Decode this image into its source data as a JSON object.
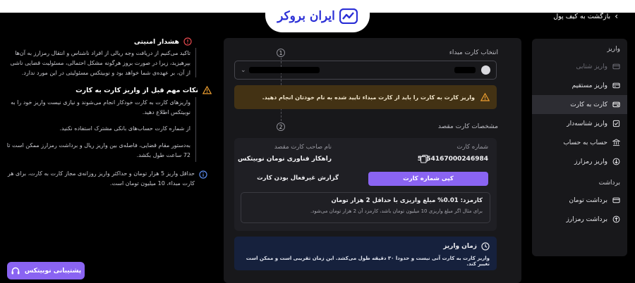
{
  "header": {
    "brand": "ایران بروکر",
    "back_label": "بازگشت به کیف پول"
  },
  "sidebar": {
    "section_deposit": "واریز",
    "deposit_items": [
      {
        "label": "واریز شتابی",
        "icon": "shetab-icon",
        "state": "disabled"
      },
      {
        "label": "واریز مستقیم",
        "icon": "bank-card-icon",
        "state": "normal"
      },
      {
        "label": "کارت به کارت",
        "icon": "card-transfer-icon",
        "state": "active"
      },
      {
        "label": "واریز شناسه‌دار",
        "icon": "id-deposit-icon",
        "state": "normal"
      },
      {
        "label": "حساب به حساب",
        "icon": "bank-building-icon",
        "state": "normal"
      },
      {
        "label": "واریز رمزارز",
        "icon": "crypto-deposit-icon",
        "state": "normal"
      }
    ],
    "section_withdraw": "برداشت",
    "withdraw_items": [
      {
        "label": "برداشت تومان",
        "icon": "toman-withdraw-icon"
      },
      {
        "label": "برداشت رمزارز",
        "icon": "crypto-withdraw-icon"
      }
    ]
  },
  "main": {
    "step1": {
      "number": "1",
      "label": "انتخاب کارت مبداء"
    },
    "step2": {
      "number": "2",
      "label": "مشخصات کارت مقصد"
    },
    "origin_warning": "واریز کارت به کارت را باید از کارت مبداء تایید شده به نام خودتان انجام دهید.",
    "destination": {
      "card_number_header": "شماره کارت",
      "owner_header": "نام صاحب کارت مقصد",
      "card_number": "5054167000246984",
      "owner_name": "راهکار فناوری نومان نوبیتکس",
      "copy_button": "کپی شماره کارت",
      "report_link": "گزارش غیرفعال بودن کارت"
    },
    "fee": {
      "title": "کارمزد: 0.01% مبلغ واریزی با حداقل 2 هزار تومان",
      "example": "برای مثال اگر مبلغ واریزی 10 میلیون تومان باشد، کارمزد آن 2 هزار تومان می‌شود."
    },
    "deposit_time": {
      "title": "زمان واریز",
      "text": "واریز کارت به کارت آنی نیست و حدودا ۳۰ دقیقه طول می‌کشد. این زمان تقریبی است و ممکن است تغییر کند."
    }
  },
  "notices": {
    "security_title": "هشدار امنیتی",
    "security_text": "تاکید می‌کنیم از دریافت وجه ریالی از افراد ناشناس و انتقال رمزارز به آن‌ها بپرهیزید، زیرا در صورت بروز هرگونه مشکل احتمالی، مسئولیت قضایی ناشی از آن، بر عهده‌ی شما خواهد بود و نوبیتکس مسئولیتی در این مورد ندارد.",
    "tips_title": "نکات مهم قبل از واریز کارت به کارت",
    "tip1": "واریزهای کارت به کارت خودکار انجام می‌شوند و نیازی نیست واریز خود را به نوبیتکس اطلاع دهید.",
    "tip2": "از شماره کارت حساب‌های بانکی مشترک استفاده نکنید.",
    "tip3": "به‌دستور مقام قضایی، فاصله‌ی بین واریز ریال و برداشت رمزارز ممکن است تا 72 ساعت طول بکشد.",
    "limit_text": "حداقل واریز 5 هزار تومان و حداکثر واریز روزانه‌ی مجاز کارت به کارت، برای هر کارت مبداء، 10 میلیون تومان است."
  },
  "support": {
    "label": "پشتیبانی نوبیتکس"
  },
  "colors": {
    "accent": "#8a64f2",
    "warning_bg": "#433214",
    "info_bg": "#16213d",
    "danger": "#e5484d",
    "warning": "#f0a030",
    "brand": "#2b2fd6"
  }
}
